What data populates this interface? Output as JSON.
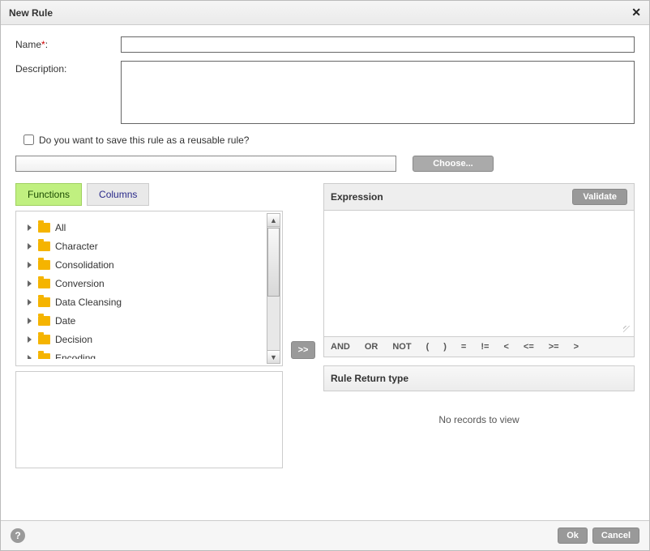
{
  "dialog": {
    "title": "New Rule"
  },
  "form": {
    "name_label": "Name",
    "required_marker": "*",
    "name_suffix": ":",
    "name_value": "",
    "description_label": "Description:",
    "description_value": "",
    "reusable_checkbox_label": "Do you want to save this rule as a reusable rule?",
    "reusable_checked": false,
    "chooser_value": "",
    "choose_button": "Choose..."
  },
  "tabs": {
    "functions": "Functions",
    "columns": "Columns",
    "active": "functions"
  },
  "tree": {
    "items": [
      {
        "label": "All"
      },
      {
        "label": "Character"
      },
      {
        "label": "Consolidation"
      },
      {
        "label": "Conversion"
      },
      {
        "label": "Data Cleansing"
      },
      {
        "label": "Date"
      },
      {
        "label": "Decision"
      },
      {
        "label": "Encoding"
      }
    ]
  },
  "transfer_button": ">>",
  "expression": {
    "header": "Expression",
    "validate_button": "Validate",
    "value": ""
  },
  "operators": [
    "AND",
    "OR",
    "NOT",
    "(",
    ")",
    "=",
    "!=",
    "<",
    "<=",
    ">=",
    ">"
  ],
  "rule_return": {
    "header": "Rule Return type",
    "empty_message": "No records to view"
  },
  "footer": {
    "help": "?",
    "ok": "Ok",
    "cancel": "Cancel"
  }
}
